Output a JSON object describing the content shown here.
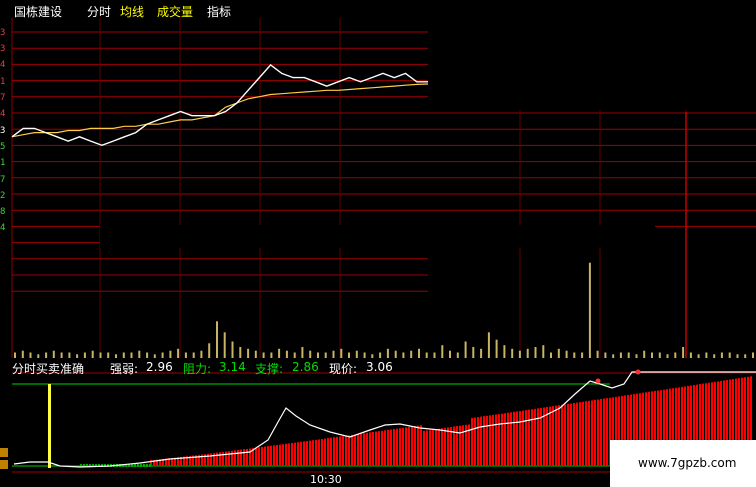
{
  "header": {
    "stock_name": "国栋建设",
    "tabs": [
      {
        "label": "分时",
        "color": "#ffffff"
      },
      {
        "label": "均线",
        "color": "#ffff00"
      },
      {
        "label": "成交量",
        "color": "#ffff00"
      },
      {
        "label": "指标",
        "color": "#ffffff"
      }
    ]
  },
  "indicator": {
    "name": "分时买卖准确",
    "strength_label": "强弱:",
    "strength_value": "2.96",
    "resistance_label": "阻力:",
    "resistance_value": "3.14",
    "support_label": "支撑:",
    "support_value": "2.86",
    "price_label": "现价:",
    "price_value": "3.06"
  },
  "time_axis": {
    "label": "10:30"
  },
  "watermark": {
    "text": "www.7gpzb.com"
  },
  "colors": {
    "grid_red": "#8b0000",
    "price_line": "#ffffff",
    "avg_line": "#ffcc44",
    "volume_bar": "#c8b464",
    "indicator_bar": "#ff0000",
    "resistance_line": "#00cc00"
  },
  "chart_data": {
    "type": "line",
    "price_series": [
      2.95,
      2.97,
      2.97,
      2.96,
      2.95,
      2.94,
      2.95,
      2.94,
      2.93,
      2.94,
      2.95,
      2.96,
      2.98,
      2.99,
      3.0,
      3.01,
      3.0,
      3.0,
      3.0,
      3.01,
      3.03,
      3.06,
      3.09,
      3.12,
      3.1,
      3.09,
      3.09,
      3.08,
      3.07,
      3.08,
      3.09,
      3.08,
      3.09,
      3.1,
      3.09,
      3.1,
      3.08,
      3.08
    ],
    "avg_series": [
      2.95,
      2.955,
      2.96,
      2.96,
      2.96,
      2.965,
      2.965,
      2.97,
      2.97,
      2.97,
      2.975,
      2.975,
      2.98,
      2.98,
      2.985,
      2.99,
      2.99,
      2.995,
      3.0,
      3.02,
      3.03,
      3.04,
      3.045,
      3.05,
      3.052,
      3.054,
      3.056,
      3.058,
      3.06,
      3.06,
      3.062,
      3.064,
      3.066,
      3.068,
      3.07,
      3.072,
      3.074,
      3.075
    ],
    "volume_series": [
      3,
      4,
      3,
      2,
      3,
      4,
      3,
      3,
      2,
      3,
      4,
      3,
      3,
      2,
      3,
      3,
      4,
      3,
      2,
      3,
      4,
      5,
      3,
      3,
      4,
      8,
      20,
      14,
      9,
      6,
      5,
      4,
      3,
      3,
      5,
      4,
      3,
      6,
      4,
      3,
      3,
      4,
      5,
      3,
      4,
      3,
      2,
      3,
      5,
      4,
      3,
      4,
      5,
      3,
      3,
      7,
      4,
      3,
      9,
      6,
      5,
      14,
      10,
      7,
      5,
      4,
      5,
      6,
      7,
      3,
      5,
      4,
      3,
      3,
      52,
      4,
      3,
      2,
      3,
      3,
      2,
      4,
      3,
      3,
      2,
      3,
      6,
      3,
      2,
      3,
      2,
      3,
      3,
      2,
      2,
      3
    ],
    "indicator": {
      "strength": 2.96,
      "resistance": 3.14,
      "support": 2.86,
      "price": 3.06
    }
  }
}
